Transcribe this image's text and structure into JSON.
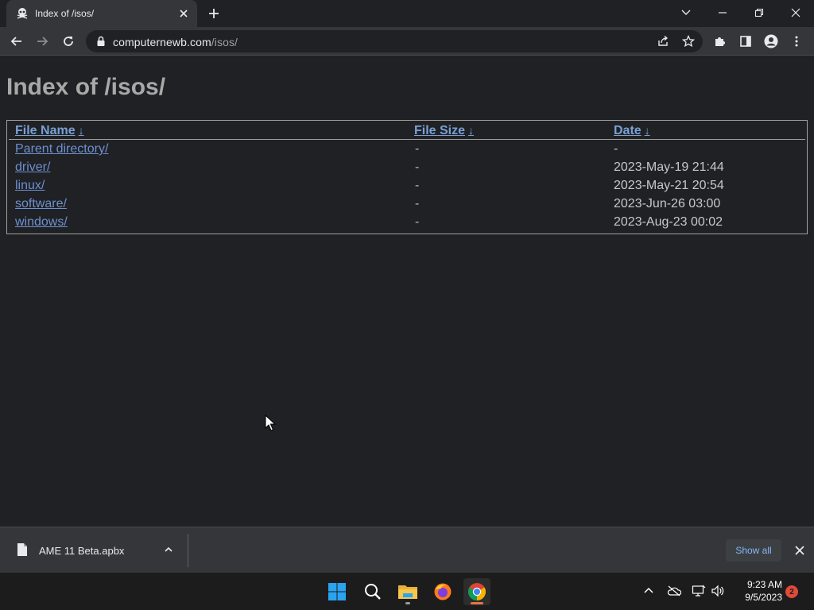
{
  "browser": {
    "tab": {
      "title": "Index of /isos/",
      "favicon": "pirate-favicon-icon"
    },
    "url": {
      "host": "computernewb.com",
      "path": "/isos/"
    },
    "icons": {
      "back": "back-arrow-icon",
      "forward": "forward-arrow-icon",
      "reload": "reload-icon",
      "share": "share-icon",
      "bookmark": "star-icon",
      "extensions": "puzzle-icon",
      "sidepanel": "side-panel-icon",
      "profile": "profile-icon",
      "menu": "kebab-menu-icon"
    }
  },
  "page": {
    "heading": "Index of /isos/",
    "columns": {
      "name": "File Name",
      "size": "File Size",
      "date": "Date",
      "sort_arrow": "↓"
    },
    "rows": [
      {
        "name": "Parent directory/",
        "size": "-",
        "date": "-"
      },
      {
        "name": "driver/",
        "size": "-",
        "date": "2023-May-19 21:44"
      },
      {
        "name": "linux/",
        "size": "-",
        "date": "2023-May-21 20:54"
      },
      {
        "name": "software/",
        "size": "-",
        "date": "2023-Jun-26 03:00"
      },
      {
        "name": "windows/",
        "size": "-",
        "date": "2023-Aug-23 00:02"
      }
    ]
  },
  "downloads": {
    "item": {
      "file_name": "AME 11 Beta.apbx"
    },
    "show_all": "Show all"
  },
  "taskbar": {
    "time": "9:23 AM",
    "date": "9/5/2023",
    "notification_count": "2"
  },
  "colors": {
    "link": "#6d8fd0",
    "heading": "#a8a8a8",
    "accent": "#8ab4f8",
    "badge": "#e04a3a"
  }
}
